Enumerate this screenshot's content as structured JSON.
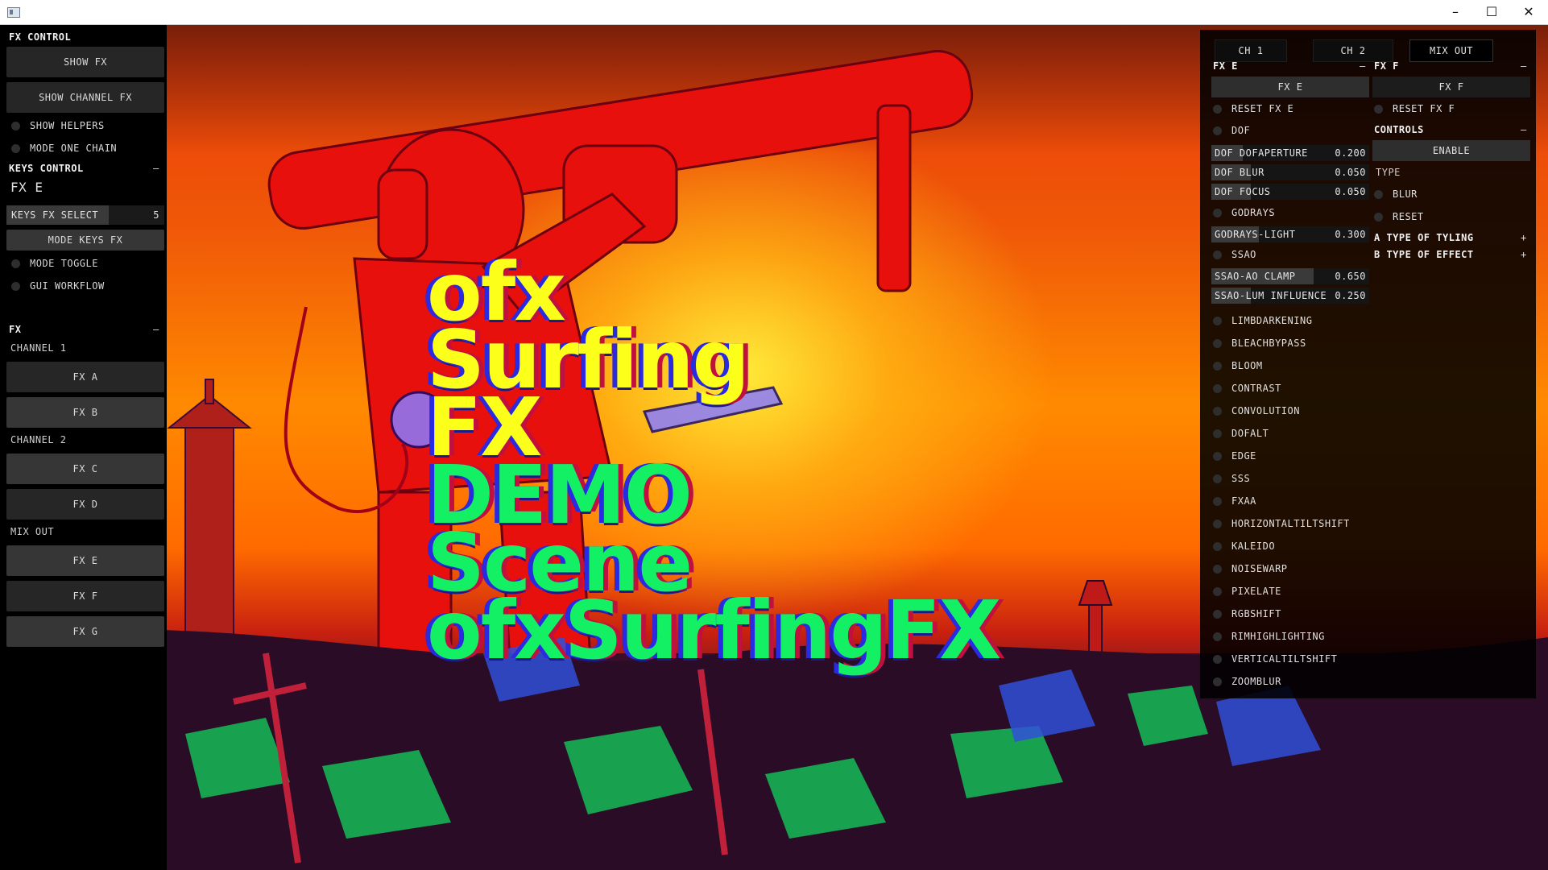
{
  "window": {
    "minimize": "–",
    "maximize": "☐",
    "close": "✕"
  },
  "headline": {
    "lines": [
      "ofx",
      "Surfing",
      "FX",
      "DEMO",
      "Scene",
      "ofxSurfingFX"
    ]
  },
  "left_panel": {
    "title": "FX CONTROL",
    "show_fx": "SHOW FX",
    "show_channel_fx": "SHOW CHANNEL FX",
    "show_helpers": "SHOW HELPERS",
    "mode_one_chain": "MODE ONE CHAIN",
    "keys_control": {
      "title": "KEYS CONTROL",
      "collapse": "–",
      "current": "FX E",
      "keys_fx_select": {
        "label": "KEYS FX SELECT",
        "value": "5",
        "fraction": 0.65
      },
      "mode_keys_fx": "MODE KEYS FX",
      "mode_toggle": "MODE TOGGLE",
      "gui_workflow": "GUI WORKFLOW"
    },
    "fx": {
      "title": "FX",
      "collapse": "–",
      "channel1": "CHANNEL 1",
      "fx_a": "FX A",
      "fx_b": "FX B",
      "channel2": "CHANNEL 2",
      "fx_c": "FX C",
      "fx_d": "FX D",
      "mix_out": "MIX OUT",
      "fx_e": "FX E",
      "fx_f": "FX F",
      "fx_g": "FX G"
    }
  },
  "right_panel": {
    "tabs": [
      "CH 1",
      "CH 2",
      "MIX OUT"
    ],
    "fx_e": {
      "title": "FX E",
      "collapse": "–",
      "button": "FX E",
      "reset": "RESET FX E",
      "dof": "DOF",
      "sliders": [
        {
          "label": "DOF DOFAPERTURE",
          "value": "0.200",
          "fraction": 0.2
        },
        {
          "label": "DOF BLUR",
          "value": "0.050",
          "fraction": 0.25
        },
        {
          "label": "DOF FOCUS",
          "value": "0.050",
          "fraction": 0.25
        }
      ],
      "godrays": "GODRAYS",
      "godrays_light": {
        "label": "GODRAYS-LIGHT",
        "value": "0.300",
        "fraction": 0.3
      },
      "ssao": "SSAO",
      "ssao_sliders": [
        {
          "label": "SSAO-AO CLAMP",
          "value": "0.650",
          "fraction": 0.65
        },
        {
          "label": "SSAO-LUM INFLUENCE",
          "value": "0.250",
          "fraction": 0.25
        }
      ],
      "effects": [
        "LIMBDARKENING",
        "BLEACHBYPASS",
        "BLOOM",
        "CONTRAST",
        "CONVOLUTION",
        "DOFALT",
        "EDGE",
        "SSS",
        "FXAA",
        "HORIZONTALTILTSHIFT",
        "KALEIDO",
        "NOISEWARP",
        "PIXELATE",
        "RGBSHIFT",
        "RIMHIGHLIGHTING",
        "VERTICALTILTSHIFT",
        "ZOOMBLUR"
      ]
    },
    "fx_f": {
      "title": "FX F",
      "collapse": "–",
      "button": "FX F",
      "reset": "RESET FX F",
      "controls": "CONTROLS",
      "controls_collapse": "–",
      "enable": "ENABLE",
      "type": "TYPE",
      "blur": "BLUR",
      "reset_toggle": "RESET",
      "type_of_tyling": "A TYPE OF TYLING",
      "type_of_effect": "B TYPE OF EFFECT",
      "expand": "+"
    }
  }
}
